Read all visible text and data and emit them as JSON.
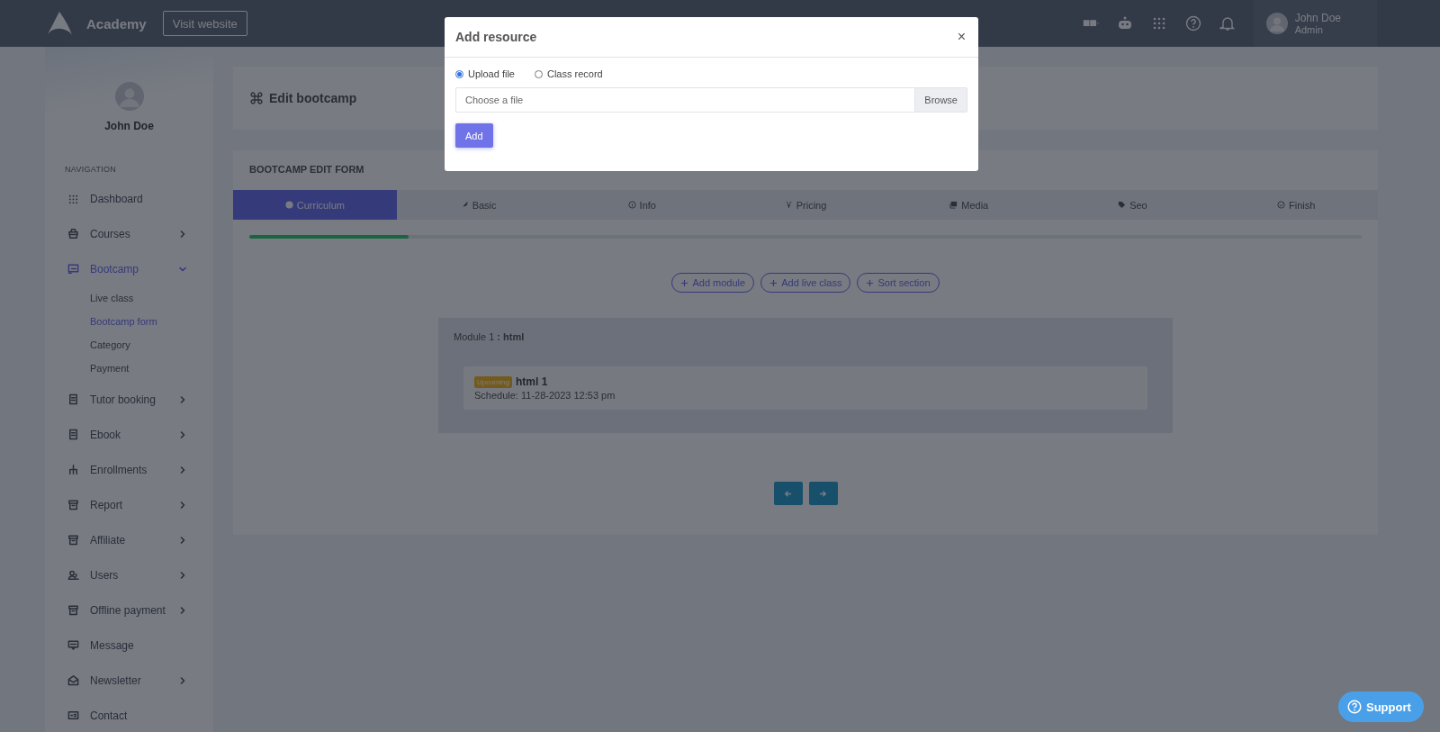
{
  "header": {
    "brand": "Academy",
    "visit_button": "Visit website",
    "user": {
      "name": "John Doe",
      "role": "Admin"
    }
  },
  "sidebar": {
    "profile_name": "John Doe",
    "section_label": "NAVIGATION",
    "items": [
      {
        "label": "Dashboard",
        "selected": false
      },
      {
        "label": "Courses",
        "expanded": false,
        "selected": false
      },
      {
        "label": "Bootcamp",
        "expanded": true,
        "selected": true,
        "children": [
          {
            "label": "Live class",
            "selected": false
          },
          {
            "label": "Bootcamp form",
            "selected": true
          },
          {
            "label": "Category",
            "selected": false
          },
          {
            "label": "Payment",
            "selected": false
          }
        ]
      },
      {
        "label": "Tutor booking",
        "expanded": false,
        "selected": false
      },
      {
        "label": "Ebook",
        "expanded": false,
        "selected": false
      },
      {
        "label": "Enrollments",
        "expanded": false,
        "selected": false
      },
      {
        "label": "Report",
        "expanded": false,
        "selected": false
      },
      {
        "label": "Affiliate",
        "expanded": false,
        "selected": false
      },
      {
        "label": "Users",
        "expanded": false,
        "selected": false
      },
      {
        "label": "Offline payment",
        "expanded": false,
        "selected": false
      },
      {
        "label": "Message",
        "selected": false
      },
      {
        "label": "Newsletter",
        "expanded": false,
        "selected": false
      },
      {
        "label": "Contact",
        "selected": false
      }
    ]
  },
  "page_title": "Edit bootcamp",
  "form": {
    "title": "BOOTCAMP EDIT FORM",
    "tabs": [
      {
        "label": "Curriculum",
        "selected": true
      },
      {
        "label": "Basic",
        "selected": false
      },
      {
        "label": "Info",
        "selected": false
      },
      {
        "label": "Pricing",
        "selected": false
      },
      {
        "label": "Media",
        "selected": false
      },
      {
        "label": "Seo",
        "selected": false
      },
      {
        "label": "Finish",
        "selected": false
      }
    ],
    "progress": {
      "level": 0.143
    },
    "actions": [
      "Add module",
      "Add live class",
      "Sort section"
    ],
    "module": {
      "title": "Module 1 **: html**",
      "classes": [
        {
          "badge": "Upcoming",
          "title": "html 1",
          "schedule": "Schedule: 11-28-2023 12:53 pm"
        }
      ]
    }
  },
  "modal": {
    "title": "Add resource",
    "close": "×",
    "options": [
      {
        "label": "Upload file",
        "selected": true
      },
      {
        "label": "Class record",
        "selected": false
      }
    ],
    "file_field": {
      "placeholder": "Choose a file",
      "browse": "Browse"
    },
    "submit": "Add"
  },
  "support": "Support"
}
